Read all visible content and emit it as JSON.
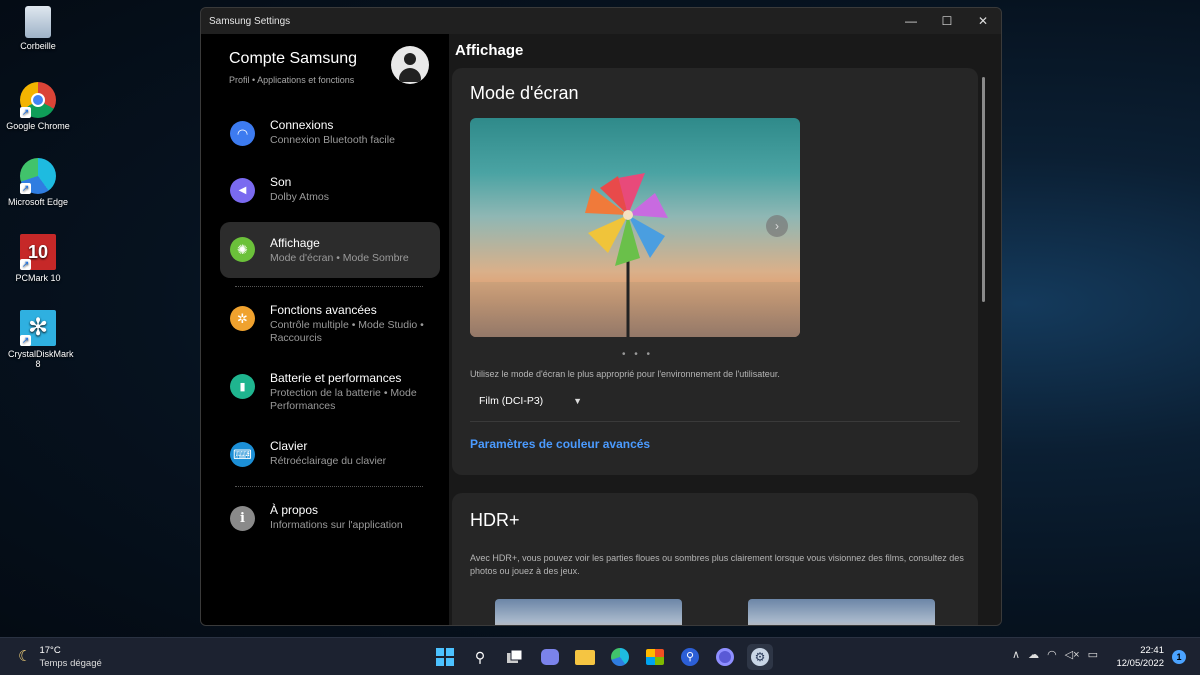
{
  "desktop": {
    "icons": [
      {
        "label": "Corbeille",
        "icon": "recycle-bin-icon"
      },
      {
        "label": "Google Chrome",
        "icon": "chrome-icon"
      },
      {
        "label": "Microsoft Edge",
        "icon": "edge-icon"
      },
      {
        "label": "PCMark 10",
        "icon": "pcmark-icon",
        "badge": "10"
      },
      {
        "label": "CrystalDiskMark 8",
        "icon": "crystaldiskmark-icon"
      }
    ]
  },
  "window": {
    "title": "Samsung Settings",
    "controls": {
      "minimize": "—",
      "maximize": "☐",
      "close": "✕"
    }
  },
  "sidebar": {
    "account_name": "Compte Samsung",
    "account_sub": "Profil • Applications et fonctions",
    "items": [
      {
        "title": "Connexions",
        "desc": "Connexion Bluetooth facile",
        "icon": "wifi-icon",
        "color": "#3d7bf0",
        "glyph": "◠"
      },
      {
        "title": "Son",
        "desc": "Dolby Atmos",
        "icon": "speaker-icon",
        "color": "#7a6af0",
        "glyph": "◀"
      },
      {
        "title": "Affichage",
        "desc": "Mode d'écran  •  Mode Sombre",
        "icon": "brightness-icon",
        "color": "#6bc13a",
        "glyph": "✺",
        "active": true
      },
      {
        "title": "Fonctions avancées",
        "desc": "Contrôle multiple  •  Mode Studio  •  Raccourcis",
        "icon": "advanced-features-icon",
        "color": "#f0a22e",
        "glyph": "✲"
      },
      {
        "title": "Batterie et performances",
        "desc": "Protection de la batterie  •  Mode Performances",
        "icon": "battery-icon",
        "color": "#1fb58f",
        "glyph": "▮"
      },
      {
        "title": "Clavier",
        "desc": "Rétroéclairage du clavier",
        "icon": "keyboard-icon",
        "color": "#1c8fd6",
        "glyph": "⌨"
      },
      {
        "title": "À propos",
        "desc": "Informations sur l'application",
        "icon": "info-icon",
        "color": "#8a8a8a",
        "glyph": "i"
      }
    ]
  },
  "content": {
    "title": "Affichage",
    "screen_mode": {
      "heading": "Mode d'écran",
      "help": "Utilisez le mode d'écran le plus approprié pour l'environnement de l'utilisateur.",
      "selected": "Film (DCI-P3)",
      "link": "Paramètres de couleur avancés",
      "carousel_dots": "• • •"
    },
    "hdr": {
      "heading": "HDR+",
      "text": "Avec HDR+, vous pouvez voir les parties floues ou sombres plus clairement lorsque vous visionnez des films, consultez des photos ou jouez à des jeux."
    }
  },
  "taskbar": {
    "weather_temp": "17°C",
    "weather_desc": "Temps dégagé",
    "apps": [
      {
        "icon": "windows-start-icon"
      },
      {
        "icon": "search-icon"
      },
      {
        "icon": "task-view-icon"
      },
      {
        "icon": "teams-chat-icon"
      },
      {
        "icon": "file-explorer-icon"
      },
      {
        "icon": "edge-icon"
      },
      {
        "icon": "microsoft-store-icon"
      },
      {
        "icon": "samsung-search-icon"
      },
      {
        "icon": "app-icon"
      },
      {
        "icon": "samsung-settings-icon",
        "active": true
      }
    ],
    "time": "22:41",
    "date": "12/05/2022",
    "notifications": "1"
  }
}
